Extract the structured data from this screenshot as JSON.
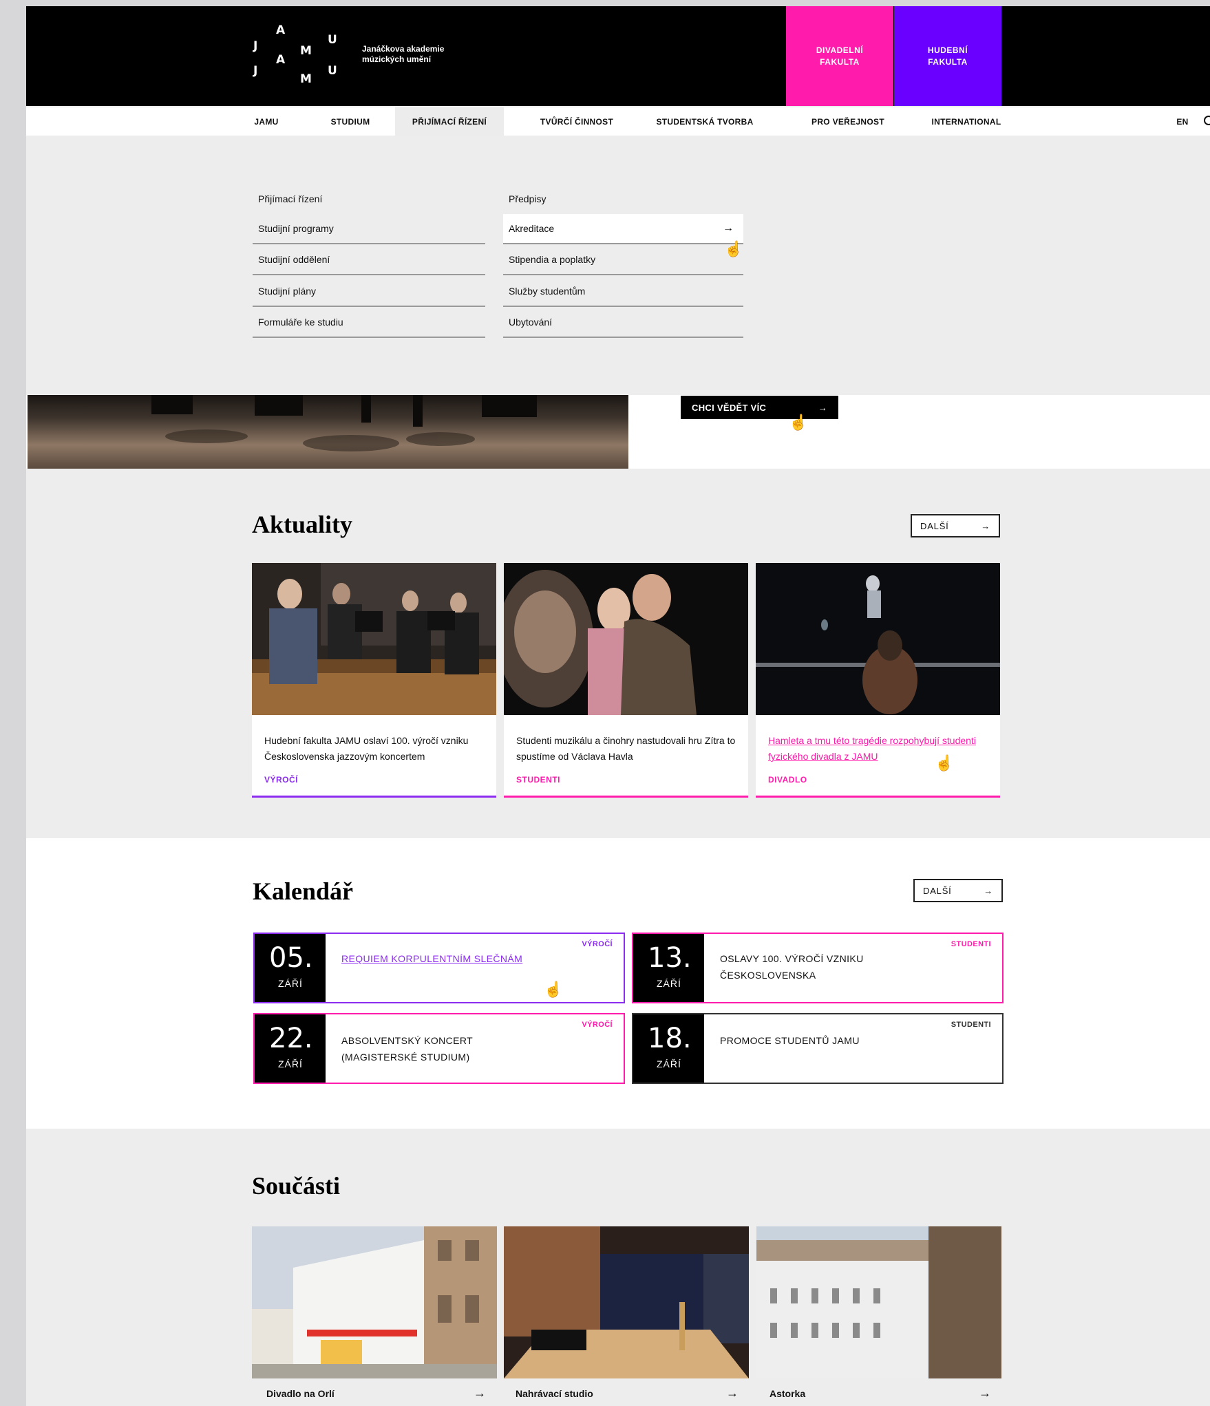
{
  "header": {
    "logo_letters": [
      "J",
      "A",
      "M",
      "U",
      "A",
      "J",
      "M",
      "U"
    ],
    "logo_text": "Janáčkova akademie múzických umění",
    "faculties": [
      "DIVADELNÍ FAKULTA",
      "HUDEBNÍ FAKULTA"
    ]
  },
  "nav": {
    "items": [
      "JAMU",
      "STUDIUM",
      "PŘIJÍMACÍ ŘÍZENÍ",
      "TVŮRČÍ ČINNOST",
      "STUDENTSKÁ TVORBA",
      "PRO VEŘEJNOST",
      "INTERNATIONAL"
    ],
    "active_index": 2,
    "lang": "EN"
  },
  "menu": {
    "col1": [
      "Přijímací řízení",
      "Studijní programy",
      "Studijní oddělení",
      "Studijní plány",
      "Formuláře ke studiu"
    ],
    "col2": [
      "Předpisy",
      "Akreditace",
      "Stipendia a poplatky",
      "Služby studentům",
      "Ubytování"
    ],
    "arrow": "→"
  },
  "hero": {
    "cta_label": "CHCI VĚDĚT VÍC",
    "arrow": "→"
  },
  "news": {
    "heading": "Aktuality",
    "more_label": "DALŠÍ",
    "arrow": "→",
    "items": [
      {
        "title": "Hudební fakulta JAMU oslaví 100. výročí vzniku Československa jazzovým koncertem",
        "tag": "VÝROČÍ",
        "color": "#8b2cf0"
      },
      {
        "title": "Studenti muzikálu a činohry nastudovali hru Zítra to spustíme od Václava Havla",
        "tag": "STUDENTI",
        "color": "#ff1bab"
      },
      {
        "title": "Hamleta a tmu této tragédie rozpohybují studenti fyzického divadla z JAMU",
        "tag": "DIVADLO",
        "color": "#ff1bab"
      }
    ]
  },
  "calendar": {
    "heading": "Kalendář",
    "more_label": "DALŠÍ",
    "arrow": "→",
    "items": [
      {
        "day": "05.",
        "month": "ZÁŘÍ",
        "title": "REQUIEM KORPULENTNÍM SLEČNÁM",
        "tag": "VÝROČÍ",
        "color": "#8b2cf0"
      },
      {
        "day": "13.",
        "month": "ZÁŘÍ",
        "title": "OSLAVY 100. VÝROČÍ VZNIKU ČESKOSLOVENSKA",
        "tag": "STUDENTI",
        "color": "#ff1bab"
      },
      {
        "day": "22.",
        "month": "ZÁŘÍ",
        "title": "ABSOLVENTSKÝ KONCERT (MAGISTERSKÉ STUDIUM)",
        "tag": "VÝROČÍ",
        "color": "#ff1bab"
      },
      {
        "day": "18.",
        "month": "ZÁŘÍ",
        "title": "PROMOCE STUDENTŮ JAMU",
        "tag": "STUDENTI",
        "color": "#333333"
      }
    ]
  },
  "parts": {
    "heading": "Součásti",
    "arrow": "→",
    "items": [
      "Divadlo na Orlí",
      "Nahrávací studio",
      "Astorka"
    ]
  }
}
